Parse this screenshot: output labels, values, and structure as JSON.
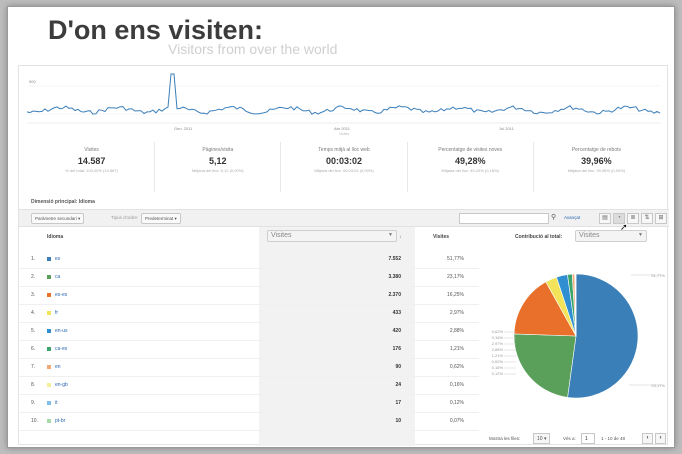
{
  "slide": {
    "title": "D'on ens visiten:",
    "ghost_subtitle": "Visitors from over the world"
  },
  "timeline": {
    "y_label": "500",
    "date_labels": [
      "Gen. 2011",
      "Abr 2011",
      "Jul 2011"
    ],
    "sub_label": "Visites"
  },
  "metrics": [
    {
      "label": "Visites",
      "value": "14.587",
      "sub": "% del total: 100,00% (14.587)"
    },
    {
      "label": "Pàgines/visita",
      "value": "5,12",
      "sub": "Mitjana del lloc: 5,12 (0,00%)"
    },
    {
      "label": "Temps mitjà al lloc web",
      "value": "00:03:02",
      "sub": "Mitjana del lloc: 00:03:02 (0,00%)"
    },
    {
      "label": "Percentatge de visites noves",
      "value": "49,28%",
      "sub": "Mitjana del lloc: 49,20% (0,16%)"
    },
    {
      "label": "Percentatge de rebots",
      "value": "39,96%",
      "sub": "Mitjana del lloc: 39,96% (0,00%)"
    }
  ],
  "dimension": "Dimensió principal: Idioma",
  "controls": {
    "secondary_dimension": "Paràmetre secundari",
    "sort_type_label": "Tipus d'ordre:",
    "sort_type_value": "Predeterminat",
    "advanced": "Avançat",
    "search_icon": "search-icon"
  },
  "table": {
    "col_language": "Idioma",
    "col_metric_select": "Visites",
    "col_visits": "Visites",
    "col_contribution": "Contribució al total:",
    "col_contribution_select": "Visites",
    "rows": [
      {
        "n": "1.",
        "lang": "es",
        "visits": "7.552",
        "pct": "51,77%",
        "color": "#3b7fb9"
      },
      {
        "n": "2.",
        "lang": "ca",
        "visits": "3.380",
        "pct": "23,17%",
        "color": "#5aa05a"
      },
      {
        "n": "3.",
        "lang": "es-es",
        "visits": "2.370",
        "pct": "16,25%",
        "color": "#e8702a"
      },
      {
        "n": "4.",
        "lang": "fr",
        "visits": "433",
        "pct": "2,97%",
        "color": "#f2e35a"
      },
      {
        "n": "5.",
        "lang": "en-us",
        "visits": "420",
        "pct": "2,88%",
        "color": "#2f8fd0"
      },
      {
        "n": "6.",
        "lang": "ca-es",
        "visits": "176",
        "pct": "1,21%",
        "color": "#3aa56b"
      },
      {
        "n": "7.",
        "lang": "en",
        "visits": "90",
        "pct": "0,62%",
        "color": "#f0a878"
      },
      {
        "n": "8.",
        "lang": "en-gb",
        "visits": "24",
        "pct": "0,16%",
        "color": "#f5ee9a"
      },
      {
        "n": "9.",
        "lang": "it",
        "visits": "17",
        "pct": "0,12%",
        "color": "#7ec0ea"
      },
      {
        "n": "10.",
        "lang": "pt-br",
        "visits": "10",
        "pct": "0,07%",
        "color": "#a8d7a8"
      }
    ]
  },
  "pie": {
    "slices": [
      51.77,
      23.17,
      16.25,
      2.97,
      2.88,
      1.21,
      0.62,
      0.16,
      0.12,
      0.07
    ],
    "label_top": "51,77%",
    "label_bottom": "23,17%",
    "left_labels": [
      "0,62%",
      "0,16%",
      "2,97%",
      "2,88%",
      "1,21%",
      "0,62%",
      "0,16%",
      "0,12%"
    ]
  },
  "paging": {
    "rows_label": "Mostra les files:",
    "rows_value": "10",
    "goto_label": "Vés a:",
    "goto_value": "1",
    "range": "1 - 10 de 48"
  }
}
